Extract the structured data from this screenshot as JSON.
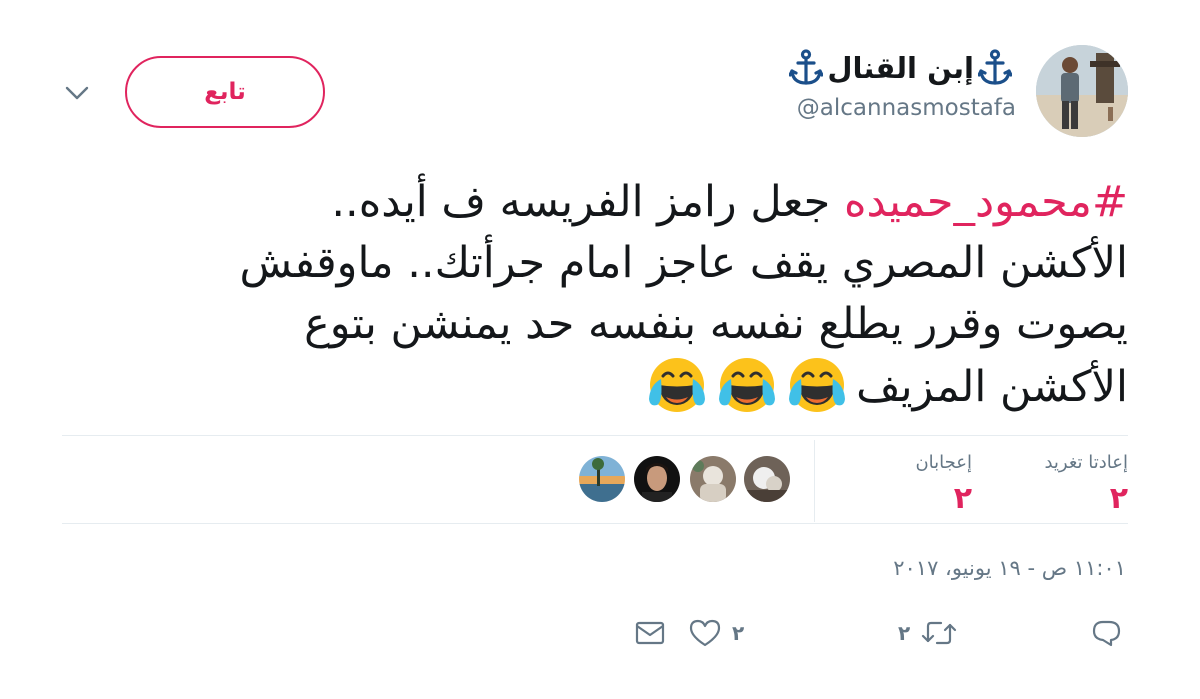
{
  "tweet": {
    "display_name": "إبن القنال",
    "username": "@alcannasmostafa",
    "follow_label": "تابع",
    "hashtag": "#محمود_حميده",
    "text_line1_rest": " جعل رامز الفريسه ف أيده..",
    "text_line2": "الأكشن المصري يقف عاجز امام جرأتك.. ماوقفش",
    "text_line3": "يصوت وقرر يطلع نفسه بنفسه حد يمنشن بتوع",
    "text_line4": "الأكشن المزيف",
    "emojis": [
      "face-with-tears-of-joy",
      "face-with-tears-of-joy",
      "face-with-tears-of-joy"
    ],
    "stats": {
      "retweets_label": "إعادتا تغريد",
      "retweets_value": "٢",
      "likes_label": "إعجابان",
      "likes_value": "٢"
    },
    "timestamp": "١١:٠١ ص - ١٩ يونيو، ٢٠١٧",
    "actions": {
      "retweet_count": "٢",
      "like_count": "٢"
    }
  },
  "colors": {
    "accent": "#e0245e",
    "text": "#14171a",
    "muted": "#657786",
    "divider": "#e6ecf0",
    "anchor": "#1b4f8a"
  },
  "icons": [
    "anchor-icon",
    "chevron-down-icon",
    "reply-icon",
    "retweet-icon",
    "heart-icon",
    "mail-icon"
  ]
}
